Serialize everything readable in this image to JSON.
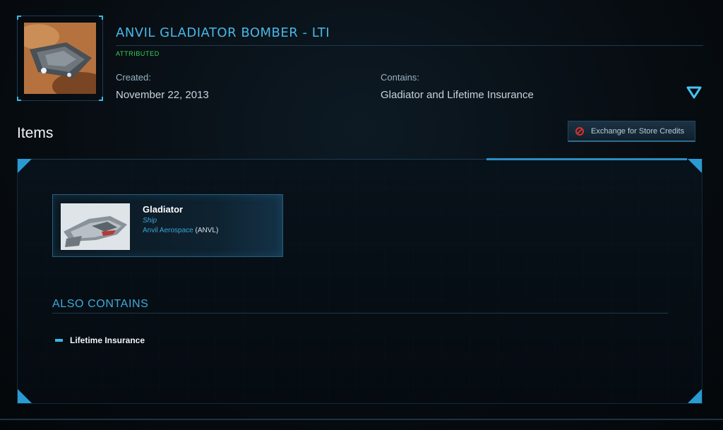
{
  "pledge": {
    "title": "ANVIL GLADIATOR BOMBER - LTI",
    "status": "ATTRIBUTED",
    "created_label": "Created:",
    "created_value": "November 22, 2013",
    "contains_label": "Contains:",
    "contains_value": "Gladiator and Lifetime Insurance",
    "expand_icon": "chevron-down-icon"
  },
  "items_section": {
    "heading": "Items",
    "exchange_button_label": "Exchange for Store Credits",
    "exchange_icon": "cancel-circle-icon"
  },
  "item": {
    "name": "Gladiator",
    "type": "Ship",
    "manufacturer": "Anvil Aerospace",
    "manufacturer_code": "(ANVL)"
  },
  "also_contains": {
    "heading": "ALSO CONTAINS",
    "items": [
      "Lifetime Insurance"
    ]
  },
  "colors": {
    "accent": "#38b8e8",
    "status_green": "#35d15a",
    "danger_red": "#d8302e"
  }
}
